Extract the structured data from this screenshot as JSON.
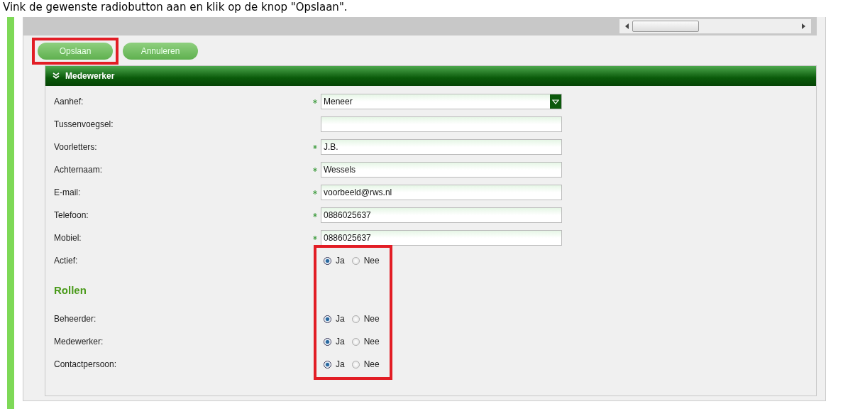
{
  "instruction": "Vink de gewenste radiobutton aan en klik op de knop \"Opslaan\".",
  "buttons": [
    {
      "label": "Opslaan",
      "highlighted": true
    },
    {
      "label": "Annuleren",
      "highlighted": false
    }
  ],
  "section": {
    "title": "Medewerker",
    "expanded": true
  },
  "fields": [
    {
      "label": "Aanhef:",
      "kind": "select",
      "required": true,
      "value": "Meneer"
    },
    {
      "label": "Tussenvoegsel:",
      "kind": "text",
      "required": false
    },
    {
      "label": "Voorletters:",
      "kind": "text",
      "required": true,
      "value": "J.B."
    },
    {
      "label": "Achternaam:",
      "kind": "text",
      "required": true,
      "value": "Wessels"
    },
    {
      "label": "E-mail:",
      "kind": "text",
      "required": true,
      "value": "voorbeeld@rws.nl"
    },
    {
      "label": "Telefoon:",
      "kind": "text",
      "required": true,
      "value": "0886025637"
    },
    {
      "label": "Mobiel:",
      "kind": "text",
      "required": true,
      "value": "0886025637"
    }
  ],
  "radio_block": {
    "highlighted": true,
    "items": [
      {
        "kind": "radio",
        "label": "Actief:",
        "options": [
          {
            "label": "Ja",
            "selected": true
          },
          {
            "label": "Nee",
            "selected": false
          }
        ]
      },
      {
        "kind": "heading",
        "label": "Rollen"
      },
      {
        "kind": "radio",
        "label": "Beheerder:",
        "options": [
          {
            "label": "Ja",
            "selected": true
          },
          {
            "label": "Nee",
            "selected": false
          }
        ]
      },
      {
        "kind": "radio",
        "label": "Medewerker:",
        "options": [
          {
            "label": "Ja",
            "selected": true
          },
          {
            "label": "Nee",
            "selected": false
          }
        ]
      },
      {
        "kind": "radio",
        "label": "Contactpersoon:",
        "options": [
          {
            "label": "Ja",
            "selected": true
          },
          {
            "label": "Nee",
            "selected": false
          }
        ]
      }
    ]
  }
}
